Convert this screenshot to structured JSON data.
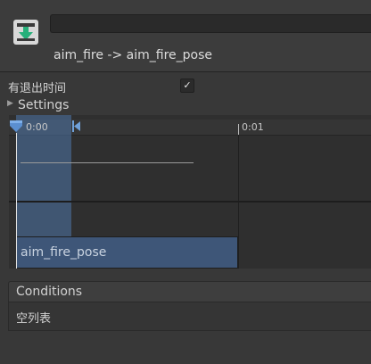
{
  "header": {
    "transition_title": "aim_fire -> aim_fire_pose",
    "name_field_value": ""
  },
  "exit_time": {
    "label": "有退出时间",
    "checked": true,
    "check_glyph": "✓"
  },
  "settings": {
    "label": "Settings",
    "expanded": false
  },
  "timeline": {
    "tick_labels": [
      "0:00",
      "0:01"
    ],
    "clip_name": "aim_fire_pose"
  },
  "conditions": {
    "title": "Conditions",
    "empty_text": "空列表"
  },
  "colors": {
    "accent": "#4e76aa",
    "clip": "#3e5678",
    "background": "#383838"
  },
  "icons": {
    "transition": "transition-arrow-icon",
    "foldout": "foldout-arrow-icon",
    "playhead": "playhead-marker-icon",
    "region_end": "region-end-marker-icon"
  }
}
